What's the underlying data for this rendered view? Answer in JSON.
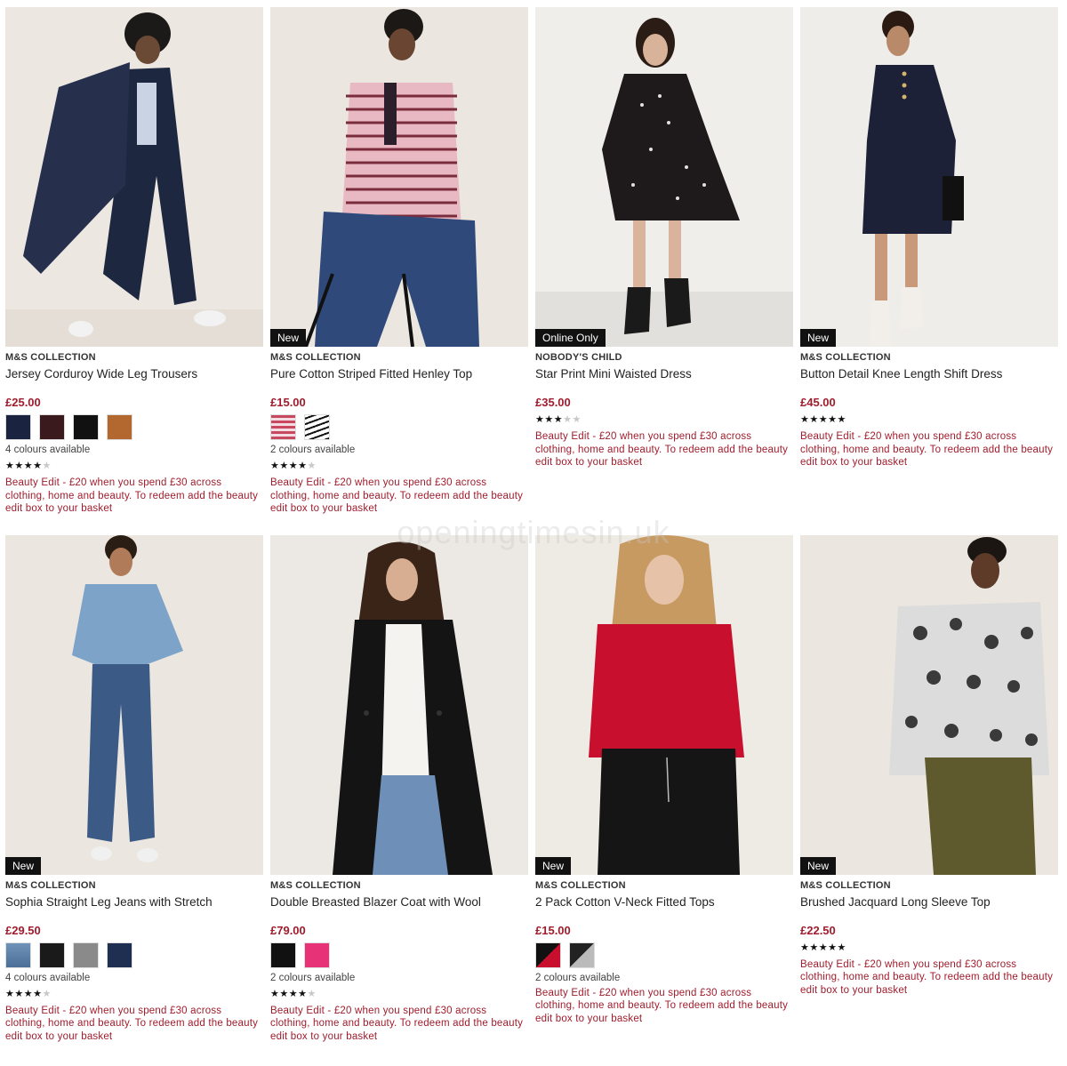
{
  "watermark": "openingtimesin.uk",
  "colors": {
    "price": "#a01c2c",
    "promo": "#a01c2c",
    "badge_bg": "#111111"
  },
  "promo_text": "Beauty Edit - £20 when you spend £30 across clothing, home and beauty. To redeem add the beauty edit box to your basket",
  "products": [
    {
      "badge": "",
      "brand": "M&S COLLECTION",
      "title": "Jersey Corduroy Wide Leg Trousers",
      "price": "£25.00",
      "swatches": [
        "#1a2440",
        "#3a1a1c",
        "#111111",
        "#b2682e"
      ],
      "colours_text": "4 colours available",
      "rating": 4,
      "promo": "Beauty Edit - £20 when you spend £30 across clothing, home and beauty. To redeem add the beauty edit box to your basket"
    },
    {
      "badge": "New",
      "brand": "M&S COLLECTION",
      "title": "Pure Cotton Striped Fitted Henley Top",
      "price": "£15.00",
      "swatches": [
        "stripes-pink",
        "stripes-bw"
      ],
      "colours_text": "2 colours available",
      "rating": 4,
      "promo": "Beauty Edit - £20 when you spend £30 across clothing, home and beauty. To redeem add the beauty edit box to your basket"
    },
    {
      "badge": "Online Only",
      "brand": "NOBODY'S CHILD",
      "title": "Star Print Mini Waisted Dress",
      "price": "£35.00",
      "swatches": [],
      "colours_text": "",
      "rating": 3,
      "promo": "Beauty Edit - £20 when you spend £30 across clothing, home and beauty. To redeem add the beauty edit box to your basket"
    },
    {
      "badge": "New",
      "brand": "M&S COLLECTION",
      "title": "Button Detail Knee Length Shift Dress",
      "price": "£45.00",
      "swatches": [],
      "colours_text": "",
      "rating": 5,
      "promo": "Beauty Edit - £20 when you spend £30 across clothing, home and beauty. To redeem add the beauty edit box to your basket"
    },
    {
      "badge": "New",
      "brand": "M&S COLLECTION",
      "title": "Sophia Straight Leg Jeans with Stretch",
      "price": "£29.50",
      "swatches": [
        "denim-light",
        "#1a1a1a",
        "#8a8a8a",
        "#1f2f52"
      ],
      "colours_text": "4 colours available",
      "rating": 4,
      "promo": "Beauty Edit - £20 when you spend £30 across clothing, home and beauty. To redeem add the beauty edit box to your basket"
    },
    {
      "badge": "",
      "brand": "M&S COLLECTION",
      "title": "Double Breasted Blazer Coat with Wool",
      "price": "£79.00",
      "swatches": [
        "#111111",
        "#e83278"
      ],
      "colours_text": "2 colours available",
      "rating": 4,
      "promo": "Beauty Edit - £20 when you spend £30 across clothing, home and beauty. To redeem add the beauty edit box to your basket"
    },
    {
      "badge": "New",
      "brand": "M&S COLLECTION",
      "title": "2 Pack Cotton V-Neck Fitted Tops",
      "price": "£15.00",
      "swatches": [
        "split-red",
        "split-grey"
      ],
      "colours_text": "2 colours available",
      "rating": 0,
      "promo": "Beauty Edit - £20 when you spend £30 across clothing, home and beauty. To redeem add the beauty edit box to your basket"
    },
    {
      "badge": "New",
      "brand": "M&S COLLECTION",
      "title": "Brushed Jacquard Long Sleeve Top",
      "price": "£22.50",
      "swatches": [],
      "colours_text": "",
      "rating": 5,
      "promo": "Beauty Edit - £20 when you spend £30 across clothing, home and beauty. To redeem add the beauty edit box to your basket"
    }
  ]
}
